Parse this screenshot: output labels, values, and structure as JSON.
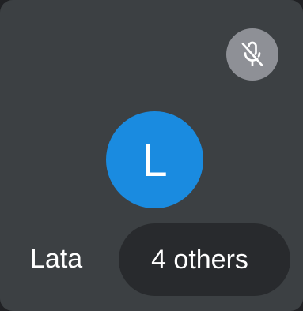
{
  "tile": {
    "mic_state": "muted",
    "icon": "mic-off-icon",
    "avatar": {
      "initial": "L",
      "color": "#1a8be0"
    },
    "participant_name": "Lata",
    "others_label": "4 others"
  }
}
